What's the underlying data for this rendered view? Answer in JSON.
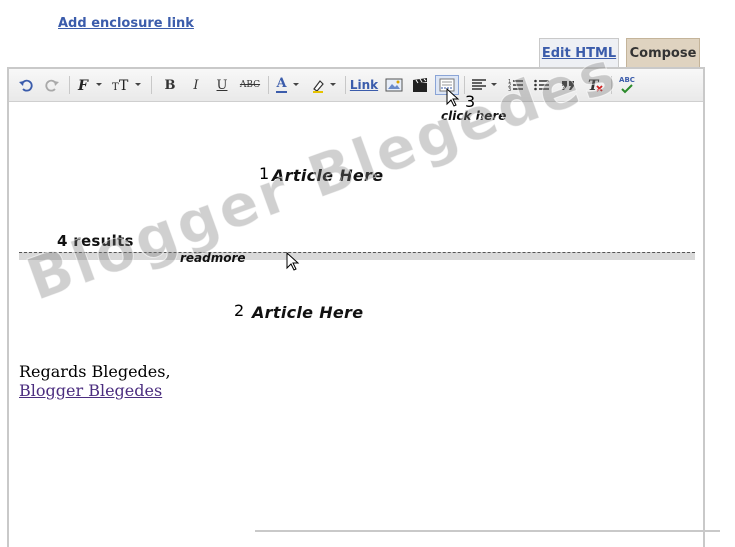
{
  "header": {
    "enclosure_link": "Add enclosure link"
  },
  "tabs": [
    {
      "label": "Edit HTML"
    },
    {
      "label": "Compose",
      "selected": true
    }
  ],
  "toolbar": {
    "undo_icon": "undo-icon",
    "redo_icon": "redo-icon",
    "font_icon": "font-family-icon",
    "font_size_icon": "font-size-icon",
    "bold": "B",
    "italic": "I",
    "underline": "U",
    "strike": "ABC",
    "text_color_label": "A",
    "link_label": "Link",
    "spellcheck_label": "ABC",
    "colors": {
      "toolbar_bg": "#eeeeee",
      "link": "#3b5cab",
      "compose_tab": "#dfd3c0"
    }
  },
  "annotations": {
    "step1": "1",
    "step2": "2",
    "step3": "3",
    "click_here": "click here"
  },
  "content": {
    "article1": "Article Here",
    "results": "4 results",
    "readmore": "readmore",
    "article2": "Article Here",
    "regards": "Regards Blegedes,",
    "blog_link": "Blogger Blegedes"
  },
  "watermark": "Blogger Blegedes"
}
